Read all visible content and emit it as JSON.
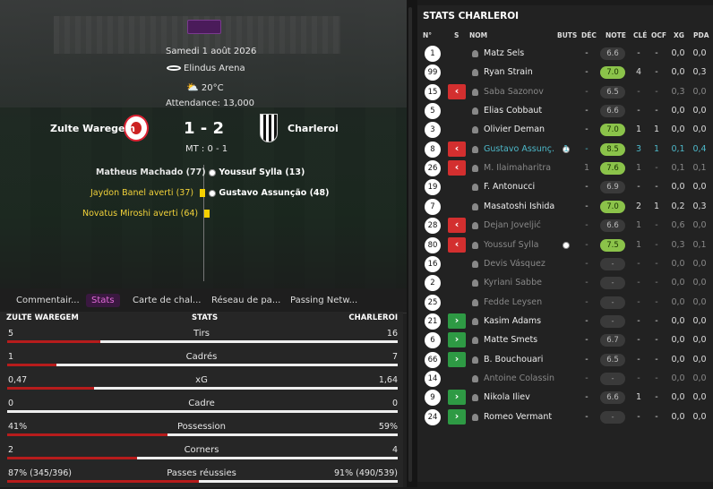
{
  "match": {
    "date": "Samedi 1 août 2026",
    "venue": "Elindus Arena",
    "weather": "20°C",
    "attendance": "Attendance: 13,000",
    "home_team": "Zulte Waregem",
    "away_team": "Charleroi",
    "score": "1 - 2",
    "halftime": "MT : 0 - 1"
  },
  "events": {
    "home": [
      {
        "text": "Matheus Machado (77)",
        "type": "goal"
      },
      {
        "text": "Jaydon Banel averti (37)",
        "type": "yellow"
      },
      {
        "text": "Novatus Miroshi averti (64)",
        "type": "yellow"
      }
    ],
    "away": [
      {
        "text": "Youssuf Sylla (13)",
        "type": "goal"
      },
      {
        "text": "Gustavo Assunção (48)",
        "type": "goal"
      }
    ]
  },
  "tabs": [
    "Commentair...",
    "Stats",
    "Carte de chal...",
    "Réseau de pa...",
    "Passing Netw..."
  ],
  "stats_header": {
    "home": "ZULTE WAREGEM",
    "mid": "STATS",
    "away": "CHARLEROI"
  },
  "stats": [
    {
      "label": "Tirs",
      "home": "5",
      "away": "16",
      "home_share": 0.238
    },
    {
      "label": "Cadrés",
      "home": "1",
      "away": "7",
      "home_share": 0.125
    },
    {
      "label": "xG",
      "home": "0,47",
      "away": "1,64",
      "home_share": 0.223
    },
    {
      "label": "Cadre",
      "home": "0",
      "away": "0",
      "home_share": 0.0
    },
    {
      "label": "Possession",
      "home": "41%",
      "away": "59%",
      "home_share": 0.41
    },
    {
      "label": "Corners",
      "home": "2",
      "away": "4",
      "home_share": 0.333
    },
    {
      "label": "Passes réussies",
      "home": "87% (345/396)",
      "away": "91% (490/539)",
      "home_share": 0.49
    }
  ],
  "team_panel": {
    "title": "STATS CHARLEROI",
    "columns": [
      "N°",
      "S",
      "NOM",
      "BUTS",
      "DÉC",
      "NOTE",
      "CLÉ",
      "OCF",
      "XG",
      "PDA"
    ],
    "players": [
      {
        "no": "1",
        "sub": "",
        "name": "Matz Sels",
        "dim": false,
        "ball": false,
        "buts": "",
        "dec": "-",
        "note": "6.6",
        "note_class": "",
        "cle": "-",
        "ocf": "-",
        "xg": "0,0",
        "pda": "0,0"
      },
      {
        "no": "99",
        "sub": "",
        "name": "Ryan Strain",
        "dim": false,
        "ball": false,
        "buts": "",
        "dec": "-",
        "note": "7.0",
        "note_class": "good",
        "cle": "4",
        "ocf": "-",
        "xg": "0,0",
        "pda": "0,3"
      },
      {
        "no": "15",
        "sub": "out",
        "name": "Saba Sazonov",
        "dim": true,
        "ball": false,
        "buts": "",
        "dec": "-",
        "note": "6.5",
        "note_class": "",
        "cle": "-",
        "ocf": "-",
        "xg": "0,3",
        "pda": "0,0"
      },
      {
        "no": "5",
        "sub": "",
        "name": "Elias Cobbaut",
        "dim": false,
        "ball": false,
        "buts": "",
        "dec": "-",
        "note": "6.6",
        "note_class": "",
        "cle": "-",
        "ocf": "-",
        "xg": "0,0",
        "pda": "0,0"
      },
      {
        "no": "3",
        "sub": "",
        "name": "Olivier Deman",
        "dim": false,
        "ball": false,
        "buts": "",
        "dec": "-",
        "note": "7.0",
        "note_class": "good",
        "cle": "1",
        "ocf": "1",
        "xg": "0,0",
        "pda": "0,0"
      },
      {
        "no": "8",
        "sub": "out",
        "name": "Gustavo Assunç...",
        "dim": false,
        "hl": true,
        "ball": true,
        "buts": "1",
        "dec": "-",
        "note": "8.5",
        "note_class": "good",
        "cle": "3",
        "ocf": "1",
        "xg": "0,1",
        "pda": "0,4"
      },
      {
        "no": "26",
        "sub": "out",
        "name": "M. Ilaimaharitra",
        "dim": true,
        "ball": false,
        "buts": "",
        "dec": "1",
        "note": "7.6",
        "note_class": "good",
        "cle": "1",
        "ocf": "-",
        "xg": "0,1",
        "pda": "0,1"
      },
      {
        "no": "19",
        "sub": "",
        "name": "F. Antonucci",
        "dim": false,
        "ball": false,
        "buts": "",
        "dec": "-",
        "note": "6.9",
        "note_class": "",
        "cle": "-",
        "ocf": "-",
        "xg": "0,0",
        "pda": "0,0"
      },
      {
        "no": "7",
        "sub": "",
        "name": "Masatoshi Ishida",
        "dim": false,
        "ball": false,
        "buts": "",
        "dec": "-",
        "note": "7.0",
        "note_class": "good",
        "cle": "2",
        "ocf": "1",
        "xg": "0,2",
        "pda": "0,3"
      },
      {
        "no": "28",
        "sub": "out",
        "name": "Dejan Joveljić",
        "dim": true,
        "ball": false,
        "buts": "",
        "dec": "-",
        "note": "6.6",
        "note_class": "",
        "cle": "1",
        "ocf": "-",
        "xg": "0,6",
        "pda": "0,0"
      },
      {
        "no": "80",
        "sub": "out",
        "name": "Youssuf Sylla",
        "dim": true,
        "ball": true,
        "buts": "",
        "dec": "-",
        "note": "7.5",
        "note_class": "good",
        "cle": "1",
        "ocf": "-",
        "xg": "0,3",
        "pda": "0,1"
      },
      {
        "no": "16",
        "sub": "",
        "name": "Devis Vásquez",
        "dim": true,
        "ball": false,
        "buts": "",
        "dec": "-",
        "note": "-",
        "note_class": "dash",
        "cle": "-",
        "ocf": "-",
        "xg": "0,0",
        "pda": "0,0"
      },
      {
        "no": "2",
        "sub": "",
        "name": "Kyriani Sabbe",
        "dim": true,
        "ball": false,
        "buts": "",
        "dec": "-",
        "note": "-",
        "note_class": "dash",
        "cle": "-",
        "ocf": "-",
        "xg": "0,0",
        "pda": "0,0"
      },
      {
        "no": "25",
        "sub": "",
        "name": "Fedde Leysen",
        "dim": true,
        "ball": false,
        "buts": "",
        "dec": "-",
        "note": "-",
        "note_class": "dash",
        "cle": "-",
        "ocf": "-",
        "xg": "0,0",
        "pda": "0,0"
      },
      {
        "no": "21",
        "sub": "in",
        "name": "Kasim Adams",
        "dim": false,
        "ball": false,
        "buts": "",
        "dec": "-",
        "note": "-",
        "note_class": "dash",
        "cle": "-",
        "ocf": "-",
        "xg": "0,0",
        "pda": "0,0"
      },
      {
        "no": "6",
        "sub": "in",
        "name": "Matte Smets",
        "dim": false,
        "ball": false,
        "buts": "",
        "dec": "-",
        "note": "6.7",
        "note_class": "",
        "cle": "-",
        "ocf": "-",
        "xg": "0,0",
        "pda": "0,0"
      },
      {
        "no": "66",
        "sub": "in",
        "name": "B. Bouchouari",
        "dim": false,
        "ball": false,
        "buts": "",
        "dec": "-",
        "note": "6.5",
        "note_class": "",
        "cle": "-",
        "ocf": "-",
        "xg": "0,0",
        "pda": "0,0"
      },
      {
        "no": "14",
        "sub": "",
        "name": "Antoine Colassin",
        "dim": true,
        "ball": false,
        "buts": "",
        "dec": "-",
        "note": "-",
        "note_class": "dash",
        "cle": "-",
        "ocf": "-",
        "xg": "0,0",
        "pda": "0,0"
      },
      {
        "no": "9",
        "sub": "in",
        "name": "Nikola Iliev",
        "dim": false,
        "ball": false,
        "buts": "",
        "dec": "-",
        "note": "6.6",
        "note_class": "",
        "cle": "1",
        "ocf": "-",
        "xg": "0,0",
        "pda": "0,0"
      },
      {
        "no": "24",
        "sub": "in",
        "name": "Romeo Vermant",
        "dim": false,
        "ball": false,
        "buts": "",
        "dec": "-",
        "note": "-",
        "note_class": "dash",
        "cle": "-",
        "ocf": "-",
        "xg": "0,0",
        "pda": "0,0"
      }
    ]
  }
}
